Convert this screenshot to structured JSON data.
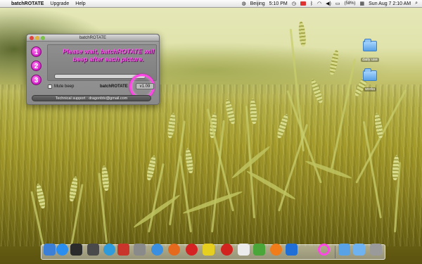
{
  "menubar": {
    "apple_glyph": "",
    "app_name": "batchROTATE",
    "menus": [
      "Upgrade",
      "Help"
    ],
    "city": "Beijing",
    "clock_time": "5:10 PM",
    "battery": "(58%)",
    "date_time": "Sun Aug 7  2:10 AM"
  },
  "window": {
    "title": "batchROTATE",
    "steps": [
      "1",
      "2",
      "3"
    ],
    "message": "Please wait, batchROTATE will beep after each picture.",
    "progress_percent": 0,
    "mute_label": "Mute beep",
    "app_label": "batchROTATE",
    "version": "v1.09",
    "support": "Technical support : dragonbtv@gmail.com"
  },
  "desktop": {
    "folders": [
      {
        "label": "daily use"
      },
      {
        "label": "works"
      }
    ]
  },
  "dock": {
    "icons": [
      {
        "name": "finder-icon",
        "color": "#3b7fd6"
      },
      {
        "name": "app-store-icon",
        "color": "#2a8ef0"
      },
      {
        "name": "dashboard-icon",
        "color": "#2b2b2b"
      },
      {
        "name": "system-preferences-icon",
        "color": "#4a4a4a"
      },
      {
        "name": "itunes-icon",
        "color": "#2f9bdb"
      },
      {
        "name": "photo-icon",
        "color": "#c9352a"
      },
      {
        "name": "preview-icon",
        "color": "#8a8a8a"
      },
      {
        "name": "safari-icon",
        "color": "#3a8fe0"
      },
      {
        "name": "firefox-icon",
        "color": "#e66a1e"
      },
      {
        "name": "opera-icon",
        "color": "#d52222"
      },
      {
        "name": "textedit-icon",
        "color": "#e6cf1e"
      },
      {
        "name": "z-app-icon",
        "color": "#d2231e"
      },
      {
        "name": "dice-icon",
        "color": "#ececec"
      },
      {
        "name": "pencil-app-icon",
        "color": "#4aa638"
      },
      {
        "name": "orange-app-icon",
        "color": "#f07c1a"
      },
      {
        "name": "fcm-app-icon",
        "color": "#1f6fd6"
      },
      {
        "name": "batchrotate-dock-icon",
        "color": "#ff47e6"
      },
      {
        "name": "folder-icon",
        "color": "#5aa2e6"
      },
      {
        "name": "downloads-icon",
        "color": "#6eb2ef"
      },
      {
        "name": "trash-icon",
        "color": "#9a9a9a"
      }
    ]
  }
}
